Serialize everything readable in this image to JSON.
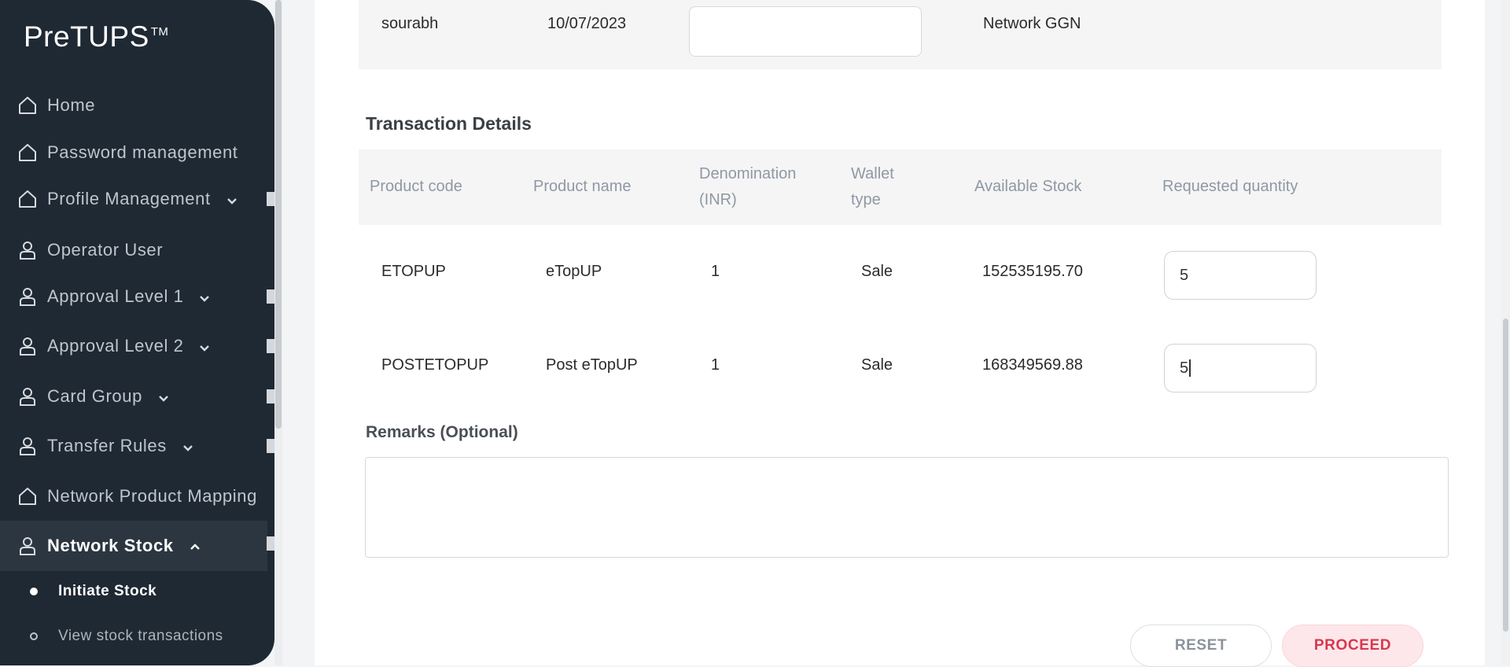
{
  "app": {
    "brand": "PreTUPS",
    "brand_mark": "TM"
  },
  "sidebar": {
    "items": [
      {
        "label": "Home",
        "icon": "home-icon"
      },
      {
        "label": "Password management",
        "icon": "home-icon"
      },
      {
        "label": "Profile Management",
        "icon": "home-icon",
        "expandable": true
      },
      {
        "label": "Operator User",
        "icon": "user-icon"
      },
      {
        "label": "Approval Level 1",
        "icon": "user-icon",
        "expandable": true
      },
      {
        "label": "Approval Level 2",
        "icon": "user-icon",
        "expandable": true
      },
      {
        "label": "Card Group",
        "icon": "user-icon",
        "expandable": true
      },
      {
        "label": "Transfer Rules",
        "icon": "user-icon",
        "expandable": true
      },
      {
        "label": "Network Product Mapping",
        "icon": "home-icon"
      },
      {
        "label": "Network Stock",
        "icon": "user-icon",
        "expandable": true,
        "expanded": true,
        "active": true
      }
    ],
    "sub_items": [
      {
        "label": "Initiate Stock",
        "active": true
      },
      {
        "label": "View stock transactions",
        "active": false
      }
    ]
  },
  "top_row": {
    "user": "sourabh",
    "date": "10/07/2023",
    "input_value": "",
    "network": "Network GGN"
  },
  "transaction": {
    "title": "Transaction Details",
    "headers": {
      "product_code": "Product code",
      "product_name": "Product name",
      "denomination_1": "Denomination",
      "denomination_2": "(INR)",
      "wallet_1": "Wallet",
      "wallet_2": "type",
      "available_stock": "Available Stock",
      "requested_quantity": "Requested quantity"
    },
    "rows": [
      {
        "product_code": "ETOPUP",
        "product_name": "eTopUP",
        "denomination": "1",
        "wallet_type": "Sale",
        "available_stock": "152535195.70",
        "requested_quantity": "5"
      },
      {
        "product_code": "POSTETOPUP",
        "product_name": "Post eTopUP",
        "denomination": "1",
        "wallet_type": "Sale",
        "available_stock": "168349569.88",
        "requested_quantity": "5"
      }
    ]
  },
  "remarks": {
    "label": "Remarks (Optional)",
    "value": ""
  },
  "buttons": {
    "reset": "RESET",
    "proceed": "PROCEED"
  },
  "colors": {
    "sidebar_bg": "#1f2933",
    "proceed_text": "#d9364f",
    "proceed_bg": "#fde7ea"
  }
}
